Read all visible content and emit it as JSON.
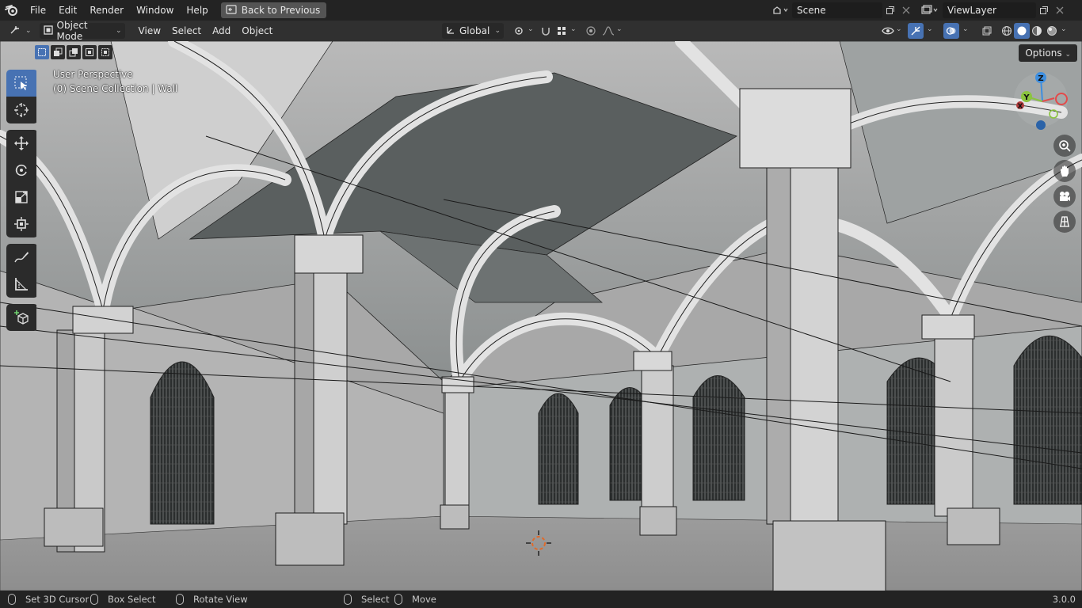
{
  "app_menu": [
    "File",
    "Edit",
    "Render",
    "Window",
    "Help"
  ],
  "back_button": "Back to Previous",
  "scene_name": "Scene",
  "view_layer": "ViewLayer",
  "header": {
    "mode": "Object Mode",
    "menus": [
      "View",
      "Select",
      "Add",
      "Object"
    ],
    "transform_orientation": "Global"
  },
  "options_label": "Options",
  "viewport": {
    "perspective": "User Perspective",
    "collection": "(0) Scene Collection | Wall"
  },
  "gizmo_axes": {
    "x": "X",
    "y": "Y",
    "z": "Z"
  },
  "status": {
    "left_click": "Set 3D Cursor",
    "drag": "Box Select",
    "middle": "Rotate View",
    "select": "Select",
    "move": "Move",
    "version": "3.0.0"
  },
  "colors": {
    "accent": "#4772b3",
    "header_bg": "#303030",
    "topbar_bg": "#232323",
    "axis_x": "#e34b4b",
    "axis_y": "#8bc43f",
    "axis_z": "#3e8fe0"
  },
  "icons": [
    "blender-logo",
    "back-icon",
    "scene-icon",
    "view-layer-icon",
    "editor-type-icon",
    "object-mode-icon",
    "orientation-icon",
    "pivot-icon",
    "snap-icon",
    "snap-increment-icon",
    "proportional-edit-icon",
    "falloff-icon",
    "visibility-icon",
    "gizmo-icon",
    "overlay-icon",
    "xray-icon",
    "wireframe-shading-icon",
    "solid-shading-icon",
    "material-shading-icon",
    "rendered-shading-icon",
    "select-box-icon",
    "cursor-icon",
    "move-icon",
    "rotate-icon",
    "scale-icon",
    "transform-icon",
    "annotate-icon",
    "measure-icon",
    "add-cube-icon",
    "zoom-icon",
    "pan-hand-icon",
    "camera-icon",
    "grid-icon"
  ]
}
